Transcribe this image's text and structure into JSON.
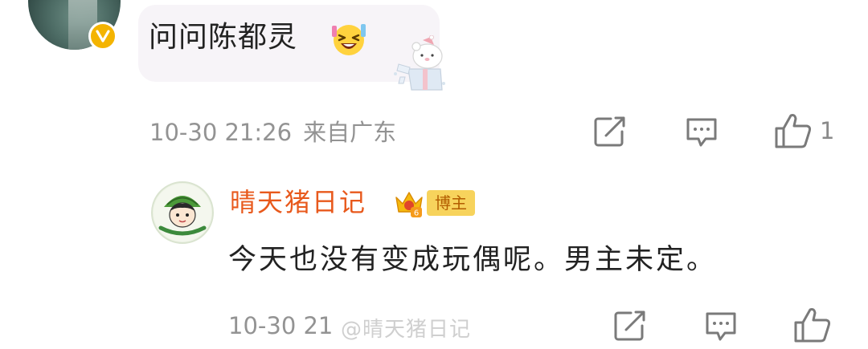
{
  "top_comment": {
    "text": "问问陈都灵",
    "emoji": "grinning-squinting-emoji",
    "decoration": "bear-gift-box-sticker",
    "avatar": "user-avatar",
    "badge": "verified-v-badge",
    "timestamp": "10-30 21:26",
    "location": "来自广东",
    "like_count": "1"
  },
  "reply": {
    "author": "晴天猪日记",
    "host_badge_label": "博主",
    "host_badge_icon": "crown-badge-icon",
    "text": "今天也没有变成玩偶呢。男主未定。",
    "timestamp_partial": "10-30 21",
    "watermark_text": "@晴天猪日记"
  },
  "icons": {
    "share": "share-icon",
    "comment": "comment-icon",
    "like": "thumbs-up-icon"
  },
  "colors": {
    "author_name": "#e8591c",
    "meta_text": "#939393",
    "badge_gold": "#f4b400",
    "bubble_bg": "#f7f4f8"
  }
}
